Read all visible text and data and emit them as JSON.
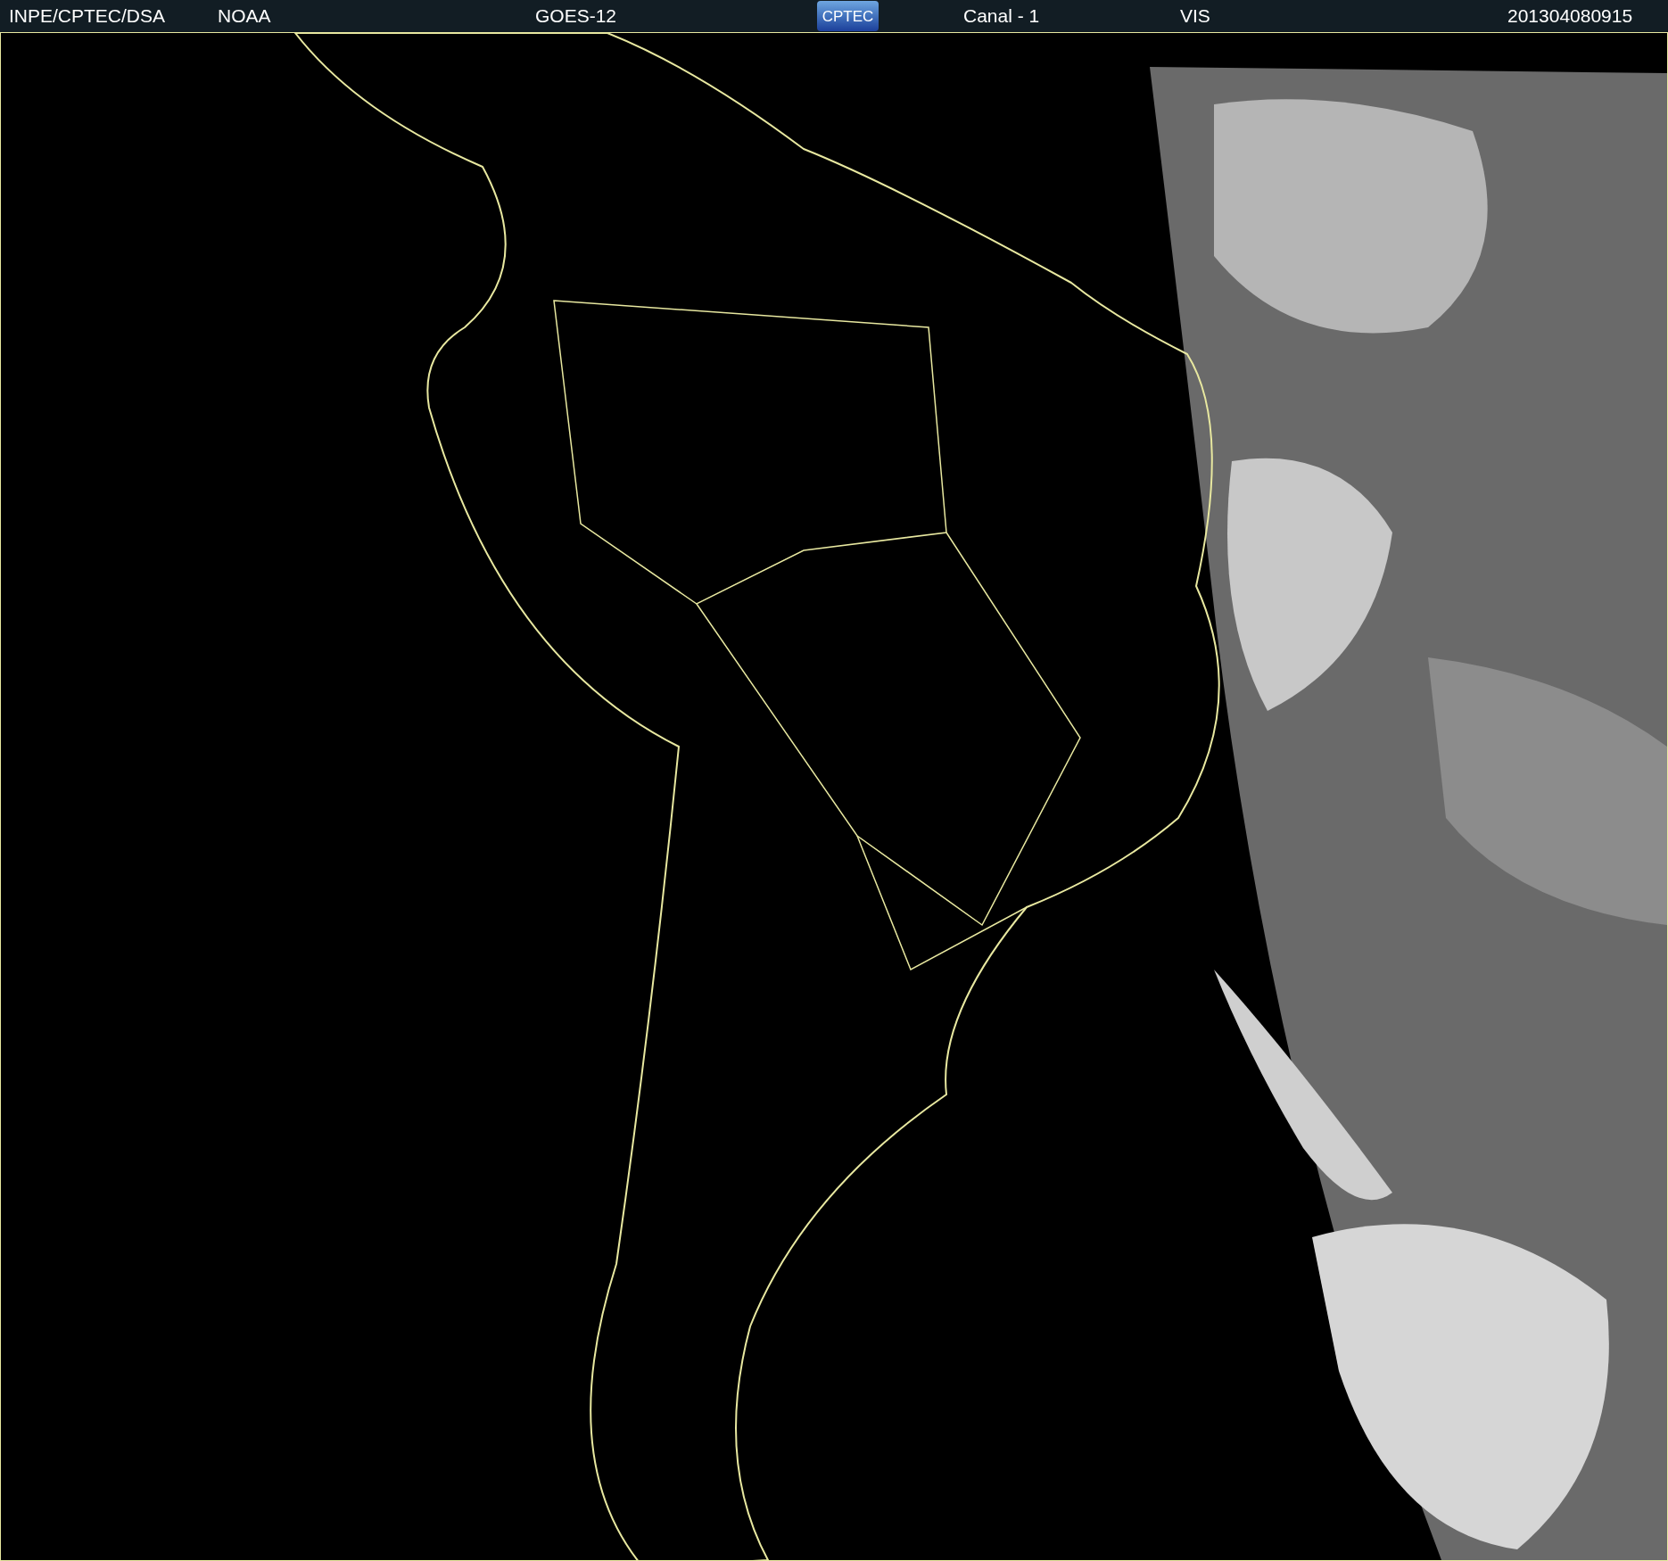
{
  "header": {
    "items": [
      {
        "kind": "text",
        "text": "INPE/CPTEC/DSA"
      },
      {
        "kind": "text",
        "text": "NOAA"
      },
      {
        "kind": "text",
        "text": "GOES-12"
      },
      {
        "kind": "logo",
        "text": "CPTEC"
      },
      {
        "kind": "text",
        "text": "Canal - 1"
      },
      {
        "kind": "text",
        "text": "VIS"
      },
      {
        "kind": "text",
        "text": "201304080915"
      }
    ]
  }
}
